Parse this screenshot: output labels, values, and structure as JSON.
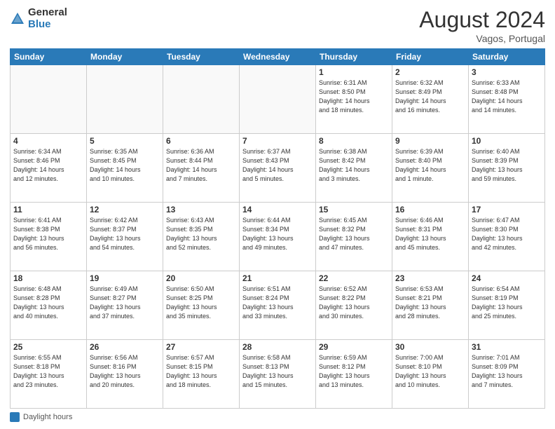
{
  "header": {
    "logo_general": "General",
    "logo_blue": "Blue",
    "title": "August 2024",
    "subtitle": "Vagos, Portugal"
  },
  "days_of_week": [
    "Sunday",
    "Monday",
    "Tuesday",
    "Wednesday",
    "Thursday",
    "Friday",
    "Saturday"
  ],
  "weeks": [
    [
      {
        "num": "",
        "info": ""
      },
      {
        "num": "",
        "info": ""
      },
      {
        "num": "",
        "info": ""
      },
      {
        "num": "",
        "info": ""
      },
      {
        "num": "1",
        "info": "Sunrise: 6:31 AM\nSunset: 8:50 PM\nDaylight: 14 hours\nand 18 minutes."
      },
      {
        "num": "2",
        "info": "Sunrise: 6:32 AM\nSunset: 8:49 PM\nDaylight: 14 hours\nand 16 minutes."
      },
      {
        "num": "3",
        "info": "Sunrise: 6:33 AM\nSunset: 8:48 PM\nDaylight: 14 hours\nand 14 minutes."
      }
    ],
    [
      {
        "num": "4",
        "info": "Sunrise: 6:34 AM\nSunset: 8:46 PM\nDaylight: 14 hours\nand 12 minutes."
      },
      {
        "num": "5",
        "info": "Sunrise: 6:35 AM\nSunset: 8:45 PM\nDaylight: 14 hours\nand 10 minutes."
      },
      {
        "num": "6",
        "info": "Sunrise: 6:36 AM\nSunset: 8:44 PM\nDaylight: 14 hours\nand 7 minutes."
      },
      {
        "num": "7",
        "info": "Sunrise: 6:37 AM\nSunset: 8:43 PM\nDaylight: 14 hours\nand 5 minutes."
      },
      {
        "num": "8",
        "info": "Sunrise: 6:38 AM\nSunset: 8:42 PM\nDaylight: 14 hours\nand 3 minutes."
      },
      {
        "num": "9",
        "info": "Sunrise: 6:39 AM\nSunset: 8:40 PM\nDaylight: 14 hours\nand 1 minute."
      },
      {
        "num": "10",
        "info": "Sunrise: 6:40 AM\nSunset: 8:39 PM\nDaylight: 13 hours\nand 59 minutes."
      }
    ],
    [
      {
        "num": "11",
        "info": "Sunrise: 6:41 AM\nSunset: 8:38 PM\nDaylight: 13 hours\nand 56 minutes."
      },
      {
        "num": "12",
        "info": "Sunrise: 6:42 AM\nSunset: 8:37 PM\nDaylight: 13 hours\nand 54 minutes."
      },
      {
        "num": "13",
        "info": "Sunrise: 6:43 AM\nSunset: 8:35 PM\nDaylight: 13 hours\nand 52 minutes."
      },
      {
        "num": "14",
        "info": "Sunrise: 6:44 AM\nSunset: 8:34 PM\nDaylight: 13 hours\nand 49 minutes."
      },
      {
        "num": "15",
        "info": "Sunrise: 6:45 AM\nSunset: 8:32 PM\nDaylight: 13 hours\nand 47 minutes."
      },
      {
        "num": "16",
        "info": "Sunrise: 6:46 AM\nSunset: 8:31 PM\nDaylight: 13 hours\nand 45 minutes."
      },
      {
        "num": "17",
        "info": "Sunrise: 6:47 AM\nSunset: 8:30 PM\nDaylight: 13 hours\nand 42 minutes."
      }
    ],
    [
      {
        "num": "18",
        "info": "Sunrise: 6:48 AM\nSunset: 8:28 PM\nDaylight: 13 hours\nand 40 minutes."
      },
      {
        "num": "19",
        "info": "Sunrise: 6:49 AM\nSunset: 8:27 PM\nDaylight: 13 hours\nand 37 minutes."
      },
      {
        "num": "20",
        "info": "Sunrise: 6:50 AM\nSunset: 8:25 PM\nDaylight: 13 hours\nand 35 minutes."
      },
      {
        "num": "21",
        "info": "Sunrise: 6:51 AM\nSunset: 8:24 PM\nDaylight: 13 hours\nand 33 minutes."
      },
      {
        "num": "22",
        "info": "Sunrise: 6:52 AM\nSunset: 8:22 PM\nDaylight: 13 hours\nand 30 minutes."
      },
      {
        "num": "23",
        "info": "Sunrise: 6:53 AM\nSunset: 8:21 PM\nDaylight: 13 hours\nand 28 minutes."
      },
      {
        "num": "24",
        "info": "Sunrise: 6:54 AM\nSunset: 8:19 PM\nDaylight: 13 hours\nand 25 minutes."
      }
    ],
    [
      {
        "num": "25",
        "info": "Sunrise: 6:55 AM\nSunset: 8:18 PM\nDaylight: 13 hours\nand 23 minutes."
      },
      {
        "num": "26",
        "info": "Sunrise: 6:56 AM\nSunset: 8:16 PM\nDaylight: 13 hours\nand 20 minutes."
      },
      {
        "num": "27",
        "info": "Sunrise: 6:57 AM\nSunset: 8:15 PM\nDaylight: 13 hours\nand 18 minutes."
      },
      {
        "num": "28",
        "info": "Sunrise: 6:58 AM\nSunset: 8:13 PM\nDaylight: 13 hours\nand 15 minutes."
      },
      {
        "num": "29",
        "info": "Sunrise: 6:59 AM\nSunset: 8:12 PM\nDaylight: 13 hours\nand 13 minutes."
      },
      {
        "num": "30",
        "info": "Sunrise: 7:00 AM\nSunset: 8:10 PM\nDaylight: 13 hours\nand 10 minutes."
      },
      {
        "num": "31",
        "info": "Sunrise: 7:01 AM\nSunset: 8:09 PM\nDaylight: 13 hours\nand 7 minutes."
      }
    ]
  ],
  "legend": {
    "label": "Daylight hours"
  }
}
